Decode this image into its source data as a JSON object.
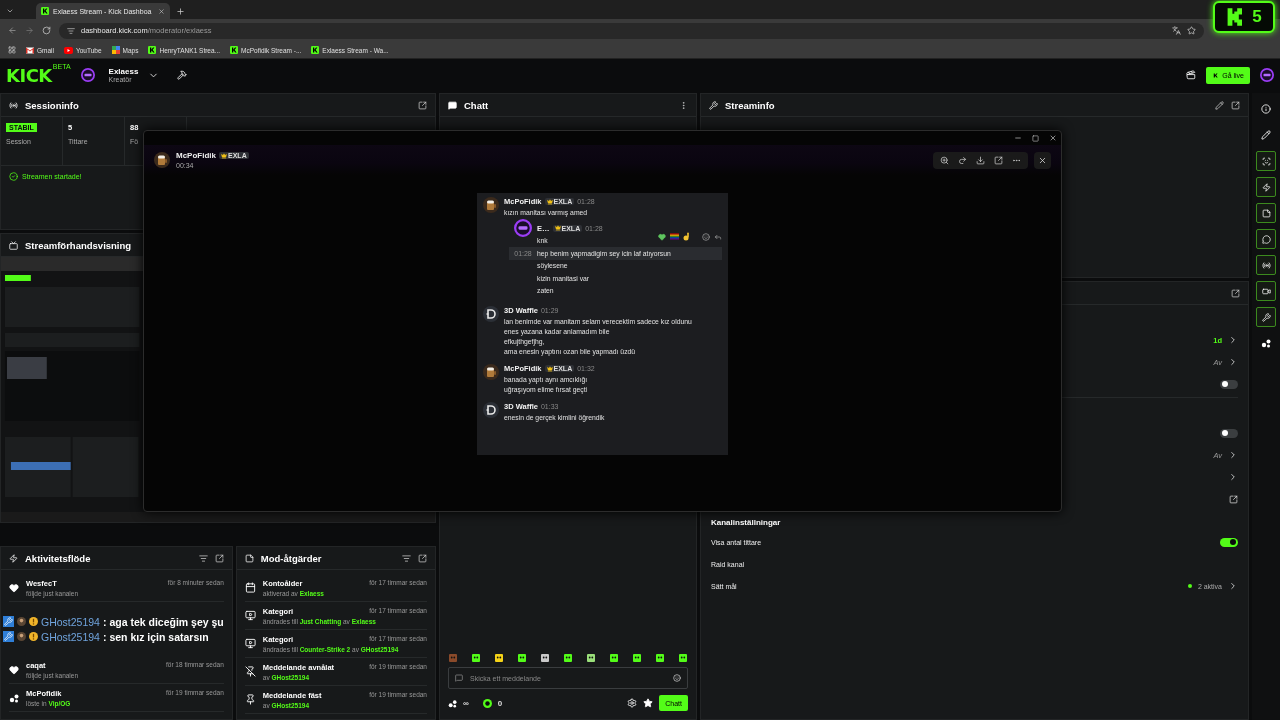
{
  "browser": {
    "tab_title": "Exlaess Stream - Kick Dashboa",
    "url_host": "dashboard.kick.com",
    "url_path": "/moderator/exlaess",
    "bookmarks": [
      {
        "kind": "gmail",
        "label": "Gmail"
      },
      {
        "kind": "youtube",
        "label": "YouTube"
      },
      {
        "kind": "maps",
        "label": "Maps"
      },
      {
        "kind": "kick",
        "label": "HenryTANK1 Strea..."
      },
      {
        "kind": "kick",
        "label": "McPofidik Stream -..."
      },
      {
        "kind": "kick",
        "label": "Exlaess Stream - Wa..."
      }
    ]
  },
  "stream_badge": {
    "count": "5"
  },
  "header": {
    "logo": "KICK",
    "logo_tag": "BETA",
    "channel": "Exlaess",
    "role": "Kreatör",
    "go_live": "Gå live"
  },
  "session": {
    "title": "Sessioninfo",
    "stats": [
      {
        "kind": "badge",
        "value": "STABIL",
        "label": "Session"
      },
      {
        "kind": "plain",
        "value": "5",
        "label": "Tittare"
      },
      {
        "kind": "plain",
        "value": "88",
        "label": "Fö"
      }
    ],
    "status": "Streamen startade!"
  },
  "preview": {
    "title": "Streamförhandsvisning"
  },
  "activity": {
    "title": "Aktivitetsflöde",
    "items": [
      {
        "kind": "follow",
        "name": "WesfecT",
        "time": "för 8 minuter sedan",
        "detail": "följde just kanalen"
      },
      {
        "kind": "chat_overlay",
        "lines": [
          {
            "user": "GHost25194",
            "text": ": aga tek diceğim şey şu"
          },
          {
            "user": "GHost25194",
            "text": ": sen kız için satarsın"
          }
        ]
      },
      {
        "kind": "follow",
        "name": "caqat",
        "time": "för 18 timmar sedan",
        "detail": "följde just kanalen"
      },
      {
        "kind": "redeem",
        "name": "McPofidik",
        "time": "för 19 timmar sedan",
        "detail": "löste in",
        "highlight": "Vip/OG"
      }
    ]
  },
  "mod_actions": {
    "title": "Mod-åtgärder",
    "items": [
      {
        "kind": "calendar",
        "title": "Kontoålder",
        "time": "för 17 timmar sedan",
        "parts": [
          {
            "text": "aktiverad av",
            "highlight": false
          },
          {
            "text": "Exlaess",
            "highlight": true
          }
        ]
      },
      {
        "kind": "category",
        "title": "Kategori",
        "time": "för 17 timmar sedan",
        "parts": [
          {
            "text": "ändrades till",
            "highlight": false
          },
          {
            "text": "Just Chatting",
            "highlight": true
          },
          {
            "text": "av",
            "highlight": false
          },
          {
            "text": "Exlaess",
            "highlight": true
          }
        ]
      },
      {
        "kind": "category",
        "title": "Kategori",
        "time": "för 17 timmar sedan",
        "parts": [
          {
            "text": "ändrades till",
            "highlight": false
          },
          {
            "text": "Counter-Strike 2",
            "highlight": true
          },
          {
            "text": "av",
            "highlight": false
          },
          {
            "text": "GHost25194",
            "highlight": true
          }
        ]
      },
      {
        "kind": "unpin",
        "title": "Meddelande avnålat",
        "time": "för 19 timmar sedan",
        "parts": [
          {
            "text": "av",
            "highlight": false
          },
          {
            "text": "GHost25194",
            "highlight": true
          }
        ]
      },
      {
        "kind": "pin",
        "title": "Meddelande fäst",
        "time": "för 19 timmar sedan",
        "parts": [
          {
            "text": "av",
            "highlight": false
          },
          {
            "text": "GHost25194",
            "highlight": true
          }
        ]
      }
    ]
  },
  "chat": {
    "title": "Chatt",
    "placeholder": "Skicka ett meddelande",
    "points": "∞",
    "coins": "0",
    "send": "Chatt"
  },
  "streaminfo": {
    "title": "Streaminfo"
  },
  "settings": {
    "rows": [
      {
        "kind": "value",
        "value": "1d",
        "accent": true
      },
      {
        "kind": "value",
        "value": "Av",
        "accent": false
      },
      {
        "kind": "toggle",
        "on": false
      }
    ],
    "rows_2": [
      {
        "kind": "toggle",
        "on": false
      },
      {
        "kind": "value",
        "value": "Av",
        "accent": false
      },
      {
        "kind": "chevron"
      },
      {
        "kind": "link"
      }
    ]
  },
  "channel_settings": {
    "title": "Kanalinställningar",
    "rows": [
      {
        "kind": "toggle",
        "label": "Visa antal tittare",
        "on": true
      },
      {
        "kind": "plain",
        "label": "Raid kanal"
      },
      {
        "kind": "count",
        "label": "Sätt mål",
        "value": "2 aktiva"
      }
    ]
  },
  "viewer": {
    "user": "McPoFidik",
    "badge": "EXLA",
    "time": "00:34",
    "messages": [
      {
        "kind": "main",
        "user": "McPoFidik",
        "badge": "EXLA",
        "time": "01:28",
        "lines": [
          {
            "text": "kızın manitası varmış amed"
          }
        ]
      },
      {
        "kind": "reply",
        "user": "E…",
        "badge": "EXLA",
        "time": "01:28",
        "lines": [
          {
            "text": "knk"
          },
          {
            "text": "hep benim yapmadigim sey icin laf atıyorsun",
            "time": "01:28"
          },
          {
            "text": "söylesene"
          },
          {
            "text": "kizin manitasi var"
          },
          {
            "text": "zaten"
          }
        ]
      },
      {
        "kind": "main",
        "user": "3D Waffle",
        "time": "01:29",
        "lines": [
          {
            "text": "lan benimde var manitam selam verecektim sadece kız oldunu"
          },
          {
            "text": "enes yazana kadar anlamadım bile"
          },
          {
            "text": "efkujthgefjhg,"
          },
          {
            "text": "ama enesin yaptını ozan bile yapmadı üzdü"
          }
        ]
      },
      {
        "kind": "main",
        "user": "McPoFidik",
        "badge": "EXLA",
        "time": "01:32",
        "lines": [
          {
            "text": "banada yaptı aynı amcıklığı"
          },
          {
            "text": "uğraşıyom elime fırsat geçti"
          }
        ]
      },
      {
        "kind": "main",
        "user": "3D Waffle",
        "time": "01:33",
        "lines": [
          {
            "text": "enesin de gerçek kimlini öğrendik"
          }
        ]
      }
    ]
  }
}
